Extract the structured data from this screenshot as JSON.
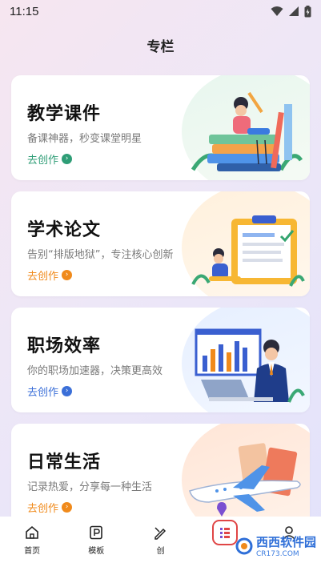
{
  "status": {
    "time": "11:15"
  },
  "header": {
    "title": "专栏"
  },
  "cards": [
    {
      "title": "教学课件",
      "subtitle": "备课神器，秒变课堂明星",
      "cta": "去创作",
      "accent": "#2e9d76"
    },
    {
      "title": "学术论文",
      "subtitle": "告别“排版地狱”，专注核心创新",
      "cta": "去创作",
      "accent": "#f08a1b"
    },
    {
      "title": "职场效率",
      "subtitle": "你的职场加速器，决策更高效",
      "cta": "去创作",
      "accent": "#3b6fd8"
    },
    {
      "title": "日常生活",
      "subtitle": "记录热爱，分享每一种生活",
      "cta": "去创作",
      "accent": "#f08a1b"
    }
  ],
  "tabbar": {
    "items": [
      {
        "label": "首页",
        "icon": "home-icon"
      },
      {
        "label": "模板",
        "icon": "template-icon"
      },
      {
        "label": "创",
        "icon": "create-icon"
      },
      {
        "label": "",
        "icon": "column-icon"
      },
      {
        "label": "",
        "icon": "profile-icon"
      }
    ]
  },
  "watermark": {
    "brand": "西西软件园",
    "domain": "CR173.COM"
  }
}
